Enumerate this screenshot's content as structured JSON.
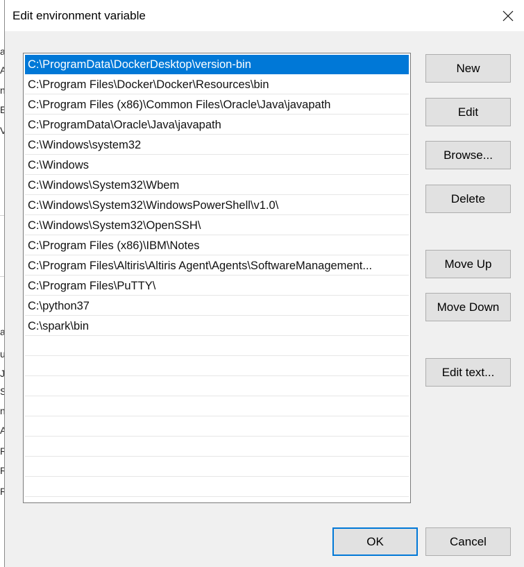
{
  "window": {
    "title": "Edit environment variable"
  },
  "background_window": {
    "glyphs": [
      "a",
      "A",
      "n",
      "E",
      "V",
      "a",
      "u",
      "J",
      "S",
      "n",
      "A",
      "R",
      "R",
      "R"
    ]
  },
  "path_list": {
    "items": [
      "C:\\ProgramData\\DockerDesktop\\version-bin",
      "C:\\Program Files\\Docker\\Docker\\Resources\\bin",
      "C:\\Program Files (x86)\\Common Files\\Oracle\\Java\\javapath",
      "C:\\ProgramData\\Oracle\\Java\\javapath",
      "C:\\Windows\\system32",
      "C:\\Windows",
      "C:\\Windows\\System32\\Wbem",
      "C:\\Windows\\System32\\WindowsPowerShell\\v1.0\\",
      "C:\\Windows\\System32\\OpenSSH\\",
      "C:\\Program Files (x86)\\IBM\\Notes",
      "C:\\Program Files\\Altiris\\Altiris Agent\\Agents\\SoftwareManagement...",
      "C:\\Program Files\\PuTTY\\",
      "C:\\python37",
      "C:\\spark\\bin"
    ],
    "selected_index": 0,
    "empty_rows": 8
  },
  "buttons": {
    "new": "New",
    "edit": "Edit",
    "browse": "Browse...",
    "delete": "Delete",
    "move_up": "Move Up",
    "move_down": "Move Down",
    "edit_text": "Edit text...",
    "ok": "OK",
    "cancel": "Cancel"
  },
  "colors": {
    "selection": "#0078d7",
    "dialog_bg": "#f0f0f0",
    "button_bg": "#e1e1e1"
  },
  "icons": {
    "close": "close-icon"
  }
}
